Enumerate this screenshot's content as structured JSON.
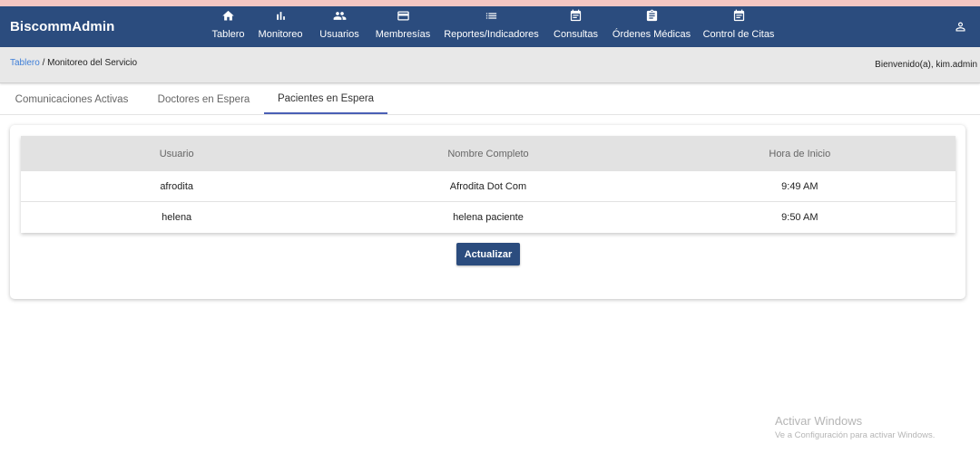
{
  "navbar": {
    "brand": "BiscommAdmin",
    "items": [
      {
        "label": "Tablero",
        "icon": "home-icon"
      },
      {
        "label": "Monitoreo",
        "icon": "bar-chart-icon"
      },
      {
        "label": "Usuarios",
        "icon": "people-icon"
      },
      {
        "label": "Membresías",
        "icon": "credit-card-icon"
      },
      {
        "label": "Reportes/Indicadores",
        "icon": "list-icon"
      },
      {
        "label": "Consultas",
        "icon": "calendar-icon"
      },
      {
        "label": "Órdenes Médicas",
        "icon": "clipboard-icon"
      },
      {
        "label": "Control de Citas",
        "icon": "calendar-icon"
      }
    ],
    "account_icon": "person-icon"
  },
  "breadcrumb": {
    "root": "Tablero",
    "separator": " / ",
    "current": "Monitoreo del Servicio"
  },
  "welcome": "Bienvenido(a), kim.admin",
  "tabs": [
    {
      "label": "Comunicaciones Activas",
      "active": false
    },
    {
      "label": "Doctores en Espera",
      "active": false
    },
    {
      "label": "Pacientes en Espera",
      "active": true
    }
  ],
  "table": {
    "headers": [
      "Usuario",
      "Nombre Completo",
      "Hora de Inicio"
    ],
    "rows": [
      [
        "afrodita",
        "Afrodita Dot Com",
        "9:49 AM"
      ],
      [
        "helena",
        "helena paciente",
        "9:50 AM"
      ]
    ]
  },
  "refresh_label": "Actualizar",
  "watermark": {
    "title": "Activar Windows",
    "subtitle": "Ve a Configuración para activar Windows."
  },
  "colors": {
    "primary": "#2b4c7e",
    "tab_indicator": "#4a5fb5",
    "link": "#3f7fd8"
  }
}
